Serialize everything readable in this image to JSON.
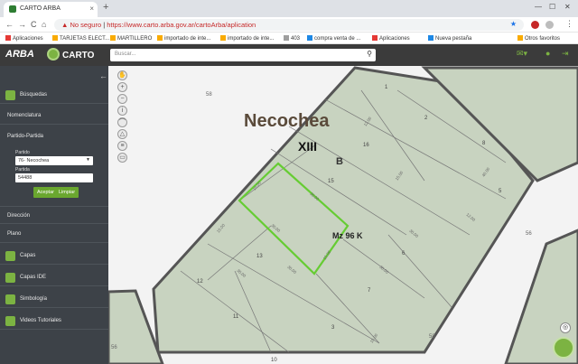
{
  "browser": {
    "tab_title": "CARTO ARBA",
    "tab_close": "×",
    "new_tab": "+",
    "url_warning": "No seguro",
    "url": "https://www.carto.arba.gov.ar/cartoArba/aplication",
    "nav_back": "←",
    "nav_forward": "→",
    "nav_reload": "C",
    "nav_home": "⌂",
    "bookmarks": [
      "Aplicaciones",
      "TARJETAS ELECT...",
      "MARTILLERO",
      "importado de inte...",
      "importado de inte...",
      "403",
      "compra venta de ...",
      "Aplicaciones",
      "Nueva pestaña"
    ],
    "other_bookmarks": "Otros favoritos"
  },
  "app": {
    "arba_logo": "ARBA",
    "carto_logo": "CARTO",
    "search_placeholder": "Buscar..."
  },
  "sidebar": {
    "busquedas": "Búsquedas",
    "nomenclatura": "Nomenclatura",
    "partido_partida": "Partido-Partida",
    "partido_label": "Partido",
    "partido_value": "76- Necochea",
    "partida_label": "Partida",
    "partida_value": "54488",
    "aceptar": "Aceptar",
    "limpiar": "Limpiar",
    "direccion": "Dirección",
    "plano": "Plano",
    "capas": "Capas",
    "capas_ide": "Capas IDE",
    "simbologia": "Simbología",
    "videos": "Videos Tutoriales"
  },
  "map": {
    "city": "Necochea",
    "section": "XIII",
    "circ": "B",
    "manzana": "Mz 96 K",
    "parcels": [
      "1",
      "2",
      "3",
      "5",
      "6",
      "7",
      "8",
      "10",
      "11",
      "12",
      "13",
      "15",
      "16"
    ],
    "streets": [
      "58",
      "56",
      "58",
      "56"
    ],
    "dims": [
      "15.00",
      "30.00",
      "15.00",
      "30.00",
      "30.00",
      "15.00",
      "15.00",
      "30.00",
      "40.00",
      "12.00",
      "12.00",
      "30.00",
      "30.00",
      "15.00"
    ],
    "highlight_color": "#66cc33",
    "block_color": "#c8d3c0"
  }
}
